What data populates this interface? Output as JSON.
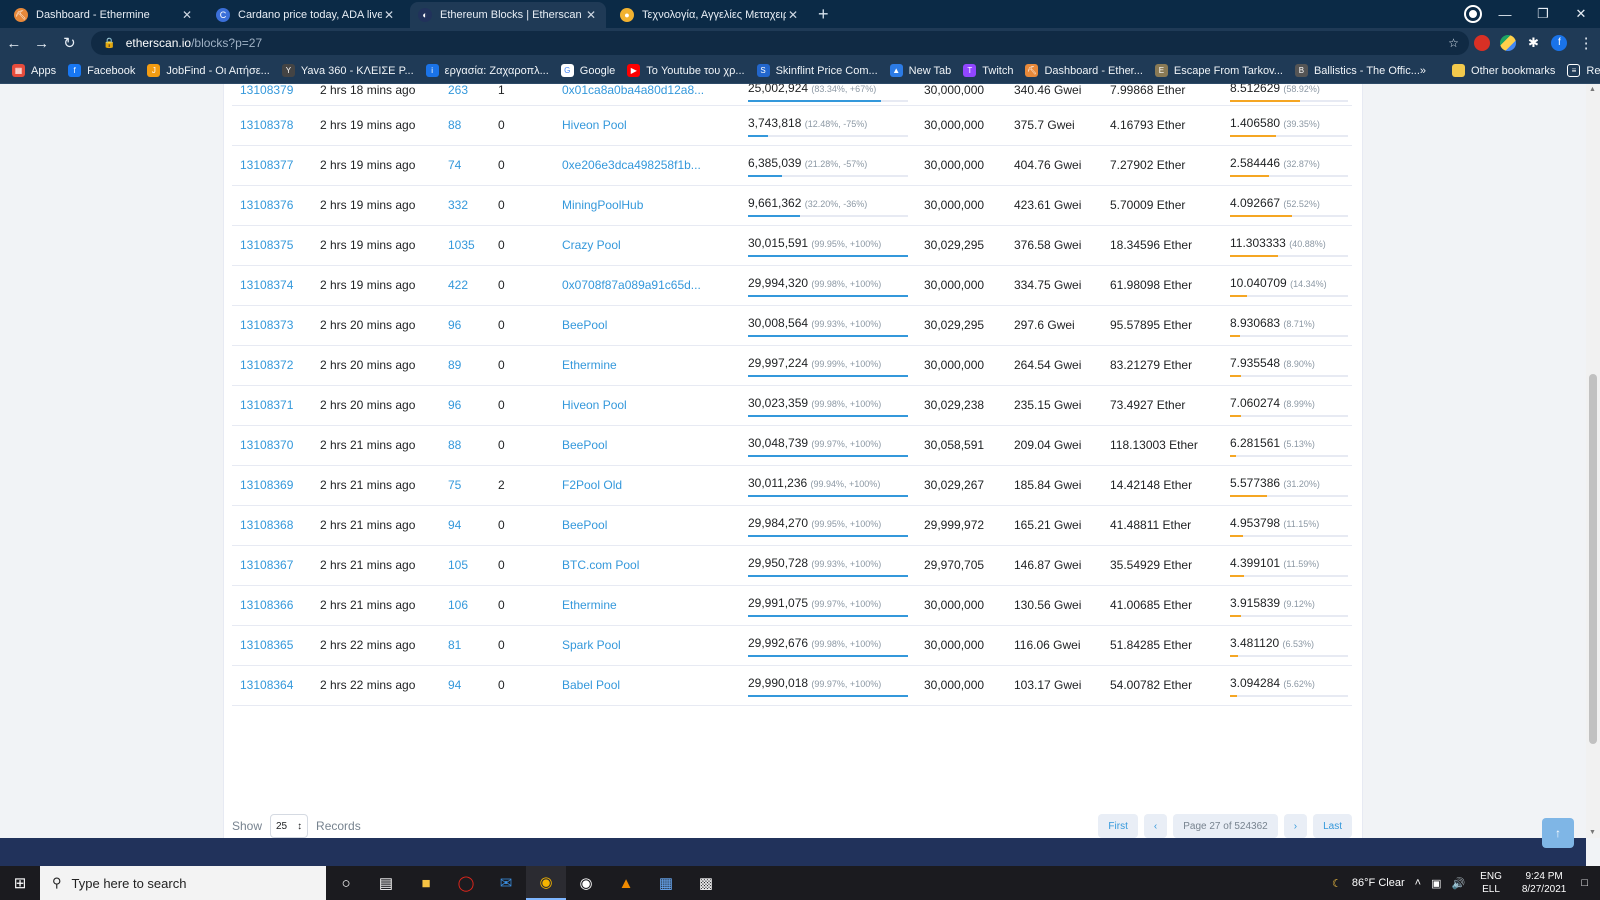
{
  "browser": {
    "tabs": [
      {
        "title": "Dashboard - Ethermine",
        "fav_color": "#e8893a",
        "fav_glyph": "⛏",
        "active": false
      },
      {
        "title": "Cardano price today, ADA live m",
        "fav_color": "#3b6fd8",
        "fav_glyph": "C",
        "active": false
      },
      {
        "title": "Ethereum Blocks | Etherscan",
        "fav_color": "#21325b",
        "fav_glyph": "◐",
        "active": true
      },
      {
        "title": "Τεχνολογία, Αγγελίες Μεταχειρι",
        "fav_color": "#f2b230",
        "fav_glyph": "●",
        "active": false
      }
    ],
    "tab_close_glyph": "✕",
    "new_tab_glyph": "+",
    "url_host": "etherscan.io",
    "url_path": "/blocks?p=27",
    "bookmarks": [
      {
        "label": "Apps",
        "color": "#e74c3c",
        "glyph": "▦"
      },
      {
        "label": "Facebook",
        "color": "#1877f2",
        "glyph": "f"
      },
      {
        "label": "JobFind - Οι Αιτήσε...",
        "color": "#f39c12",
        "glyph": "J"
      },
      {
        "label": "Yava 360 - ΚΛΕΙΣΕ Ρ...",
        "color": "#444444",
        "glyph": "Y"
      },
      {
        "label": "εργασία: Ζαχαροπλ...",
        "color": "#1a73e8",
        "glyph": "i"
      },
      {
        "label": "Google",
        "color": "#ffffff",
        "glyph": "G"
      },
      {
        "label": "Το Youtube του χρ...",
        "color": "#ff0000",
        "glyph": "▶"
      },
      {
        "label": "Skinflint Price Com...",
        "color": "#2266cc",
        "glyph": "S"
      },
      {
        "label": "New Tab",
        "color": "#2c7be5",
        "glyph": "▲"
      },
      {
        "label": "Twitch",
        "color": "#9146ff",
        "glyph": "T"
      },
      {
        "label": "Dashboard - Ether...",
        "color": "#e8893a",
        "glyph": "⛏"
      },
      {
        "label": "Escape From Tarkov...",
        "color": "#8a7a55",
        "glyph": "E"
      },
      {
        "label": "Ballistics - The Offic...",
        "color": "#555555",
        "glyph": "B"
      }
    ],
    "other_bookmarks": "Other bookmarks",
    "reading_list": "Reading list",
    "more_glyph": "»"
  },
  "blocks": [
    {
      "block": "13108379",
      "age": "2 hrs 18 mins ago",
      "txn": "263",
      "uncles": "1",
      "miner": "0x01ca8a0ba4a80d12a8...",
      "gas_used": "25,002,924",
      "gas_pct": "(83.34%, +67%)",
      "gas_fill": 0.8334,
      "gas_limit": "30,000,000",
      "base_fee": "340.46 Gwei",
      "reward": "7.99868 Ether",
      "burnt": "8.512629",
      "burnt_pct": "(58.92%)",
      "burnt_fill": 0.5892
    },
    {
      "block": "13108378",
      "age": "2 hrs 19 mins ago",
      "txn": "88",
      "uncles": "0",
      "miner": "Hiveon Pool",
      "gas_used": "3,743,818",
      "gas_pct": "(12.48%, -75%)",
      "gas_fill": 0.1248,
      "gas_limit": "30,000,000",
      "base_fee": "375.7 Gwei",
      "reward": "4.16793 Ether",
      "burnt": "1.406580",
      "burnt_pct": "(39.35%)",
      "burnt_fill": 0.3935
    },
    {
      "block": "13108377",
      "age": "2 hrs 19 mins ago",
      "txn": "74",
      "uncles": "0",
      "miner": "0xe206e3dca498258f1b...",
      "gas_used": "6,385,039",
      "gas_pct": "(21.28%, -57%)",
      "gas_fill": 0.2128,
      "gas_limit": "30,000,000",
      "base_fee": "404.76 Gwei",
      "reward": "7.27902 Ether",
      "burnt": "2.584446",
      "burnt_pct": "(32.87%)",
      "burnt_fill": 0.3287
    },
    {
      "block": "13108376",
      "age": "2 hrs 19 mins ago",
      "txn": "332",
      "uncles": "0",
      "miner": "MiningPoolHub",
      "gas_used": "9,661,362",
      "gas_pct": "(32.20%, -36%)",
      "gas_fill": 0.322,
      "gas_limit": "30,000,000",
      "base_fee": "423.61 Gwei",
      "reward": "5.70009 Ether",
      "burnt": "4.092667",
      "burnt_pct": "(52.52%)",
      "burnt_fill": 0.5252
    },
    {
      "block": "13108375",
      "age": "2 hrs 19 mins ago",
      "txn": "1035",
      "uncles": "0",
      "miner": "Crazy Pool",
      "gas_used": "30,015,591",
      "gas_pct": "(99.95%, +100%)",
      "gas_fill": 0.9995,
      "gas_limit": "30,029,295",
      "base_fee": "376.58 Gwei",
      "reward": "18.34596 Ether",
      "burnt": "11.303333",
      "burnt_pct": "(40.88%)",
      "burnt_fill": 0.4088
    },
    {
      "block": "13108374",
      "age": "2 hrs 19 mins ago",
      "txn": "422",
      "uncles": "0",
      "miner": "0x0708f87a089a91c65d...",
      "gas_used": "29,994,320",
      "gas_pct": "(99.98%, +100%)",
      "gas_fill": 0.9998,
      "gas_limit": "30,000,000",
      "base_fee": "334.75 Gwei",
      "reward": "61.98098 Ether",
      "burnt": "10.040709",
      "burnt_pct": "(14.34%)",
      "burnt_fill": 0.1434
    },
    {
      "block": "13108373",
      "age": "2 hrs 20 mins ago",
      "txn": "96",
      "uncles": "0",
      "miner": "BeePool",
      "gas_used": "30,008,564",
      "gas_pct": "(99.93%, +100%)",
      "gas_fill": 0.9993,
      "gas_limit": "30,029,295",
      "base_fee": "297.6 Gwei",
      "reward": "95.57895 Ether",
      "burnt": "8.930683",
      "burnt_pct": "(8.71%)",
      "burnt_fill": 0.0871
    },
    {
      "block": "13108372",
      "age": "2 hrs 20 mins ago",
      "txn": "89",
      "uncles": "0",
      "miner": "Ethermine",
      "gas_used": "29,997,224",
      "gas_pct": "(99.99%, +100%)",
      "gas_fill": 0.9999,
      "gas_limit": "30,000,000",
      "base_fee": "264.54 Gwei",
      "reward": "83.21279 Ether",
      "burnt": "7.935548",
      "burnt_pct": "(8.90%)",
      "burnt_fill": 0.089
    },
    {
      "block": "13108371",
      "age": "2 hrs 20 mins ago",
      "txn": "96",
      "uncles": "0",
      "miner": "Hiveon Pool",
      "gas_used": "30,023,359",
      "gas_pct": "(99.98%, +100%)",
      "gas_fill": 0.9998,
      "gas_limit": "30,029,238",
      "base_fee": "235.15 Gwei",
      "reward": "73.4927 Ether",
      "burnt": "7.060274",
      "burnt_pct": "(8.99%)",
      "burnt_fill": 0.0899
    },
    {
      "block": "13108370",
      "age": "2 hrs 21 mins ago",
      "txn": "88",
      "uncles": "0",
      "miner": "BeePool",
      "gas_used": "30,048,739",
      "gas_pct": "(99.97%, +100%)",
      "gas_fill": 0.9997,
      "gas_limit": "30,058,591",
      "base_fee": "209.04 Gwei",
      "reward": "118.13003 Ether",
      "burnt": "6.281561",
      "burnt_pct": "(5.13%)",
      "burnt_fill": 0.0513
    },
    {
      "block": "13108369",
      "age": "2 hrs 21 mins ago",
      "txn": "75",
      "uncles": "2",
      "miner": "F2Pool Old",
      "gas_used": "30,011,236",
      "gas_pct": "(99.94%, +100%)",
      "gas_fill": 0.9994,
      "gas_limit": "30,029,267",
      "base_fee": "185.84 Gwei",
      "reward": "14.42148 Ether",
      "burnt": "5.577386",
      "burnt_pct": "(31.20%)",
      "burnt_fill": 0.312
    },
    {
      "block": "13108368",
      "age": "2 hrs 21 mins ago",
      "txn": "94",
      "uncles": "0",
      "miner": "BeePool",
      "gas_used": "29,984,270",
      "gas_pct": "(99.95%, +100%)",
      "gas_fill": 0.9995,
      "gas_limit": "29,999,972",
      "base_fee": "165.21 Gwei",
      "reward": "41.48811 Ether",
      "burnt": "4.953798",
      "burnt_pct": "(11.15%)",
      "burnt_fill": 0.1115
    },
    {
      "block": "13108367",
      "age": "2 hrs 21 mins ago",
      "txn": "105",
      "uncles": "0",
      "miner": "BTC.com Pool",
      "gas_used": "29,950,728",
      "gas_pct": "(99.93%, +100%)",
      "gas_fill": 0.9993,
      "gas_limit": "29,970,705",
      "base_fee": "146.87 Gwei",
      "reward": "35.54929 Ether",
      "burnt": "4.399101",
      "burnt_pct": "(11.59%)",
      "burnt_fill": 0.1159
    },
    {
      "block": "13108366",
      "age": "2 hrs 21 mins ago",
      "txn": "106",
      "uncles": "0",
      "miner": "Ethermine",
      "gas_used": "29,991,075",
      "gas_pct": "(99.97%, +100%)",
      "gas_fill": 0.9997,
      "gas_limit": "30,000,000",
      "base_fee": "130.56 Gwei",
      "reward": "41.00685 Ether",
      "burnt": "3.915839",
      "burnt_pct": "(9.12%)",
      "burnt_fill": 0.0912
    },
    {
      "block": "13108365",
      "age": "2 hrs 22 mins ago",
      "txn": "81",
      "uncles": "0",
      "miner": "Spark Pool",
      "gas_used": "29,992,676",
      "gas_pct": "(99.98%, +100%)",
      "gas_fill": 0.9998,
      "gas_limit": "30,000,000",
      "base_fee": "116.06 Gwei",
      "reward": "51.84285 Ether",
      "burnt": "3.481120",
      "burnt_pct": "(6.53%)",
      "burnt_fill": 0.0653
    },
    {
      "block": "13108364",
      "age": "2 hrs 22 mins ago",
      "txn": "94",
      "uncles": "0",
      "miner": "Babel Pool",
      "gas_used": "29,990,018",
      "gas_pct": "(99.97%, +100%)",
      "gas_fill": 0.9997,
      "gas_limit": "30,000,000",
      "base_fee": "103.17 Gwei",
      "reward": "54.00782 Ether",
      "burnt": "3.094284",
      "burnt_pct": "(5.62%)",
      "burnt_fill": 0.0562
    }
  ],
  "pagination": {
    "show_label": "Show",
    "records_value": "25",
    "records_label": "Records",
    "first": "First",
    "prev": "‹",
    "page_info": "Page 27 of 524362",
    "next": "›",
    "last": "Last"
  },
  "taskbar": {
    "search_placeholder": "Type here to search",
    "weather": "86°F  Clear",
    "lang_line1": "ENG",
    "lang_line2": "ELL",
    "time": "9:24 PM",
    "date": "8/27/2021"
  }
}
